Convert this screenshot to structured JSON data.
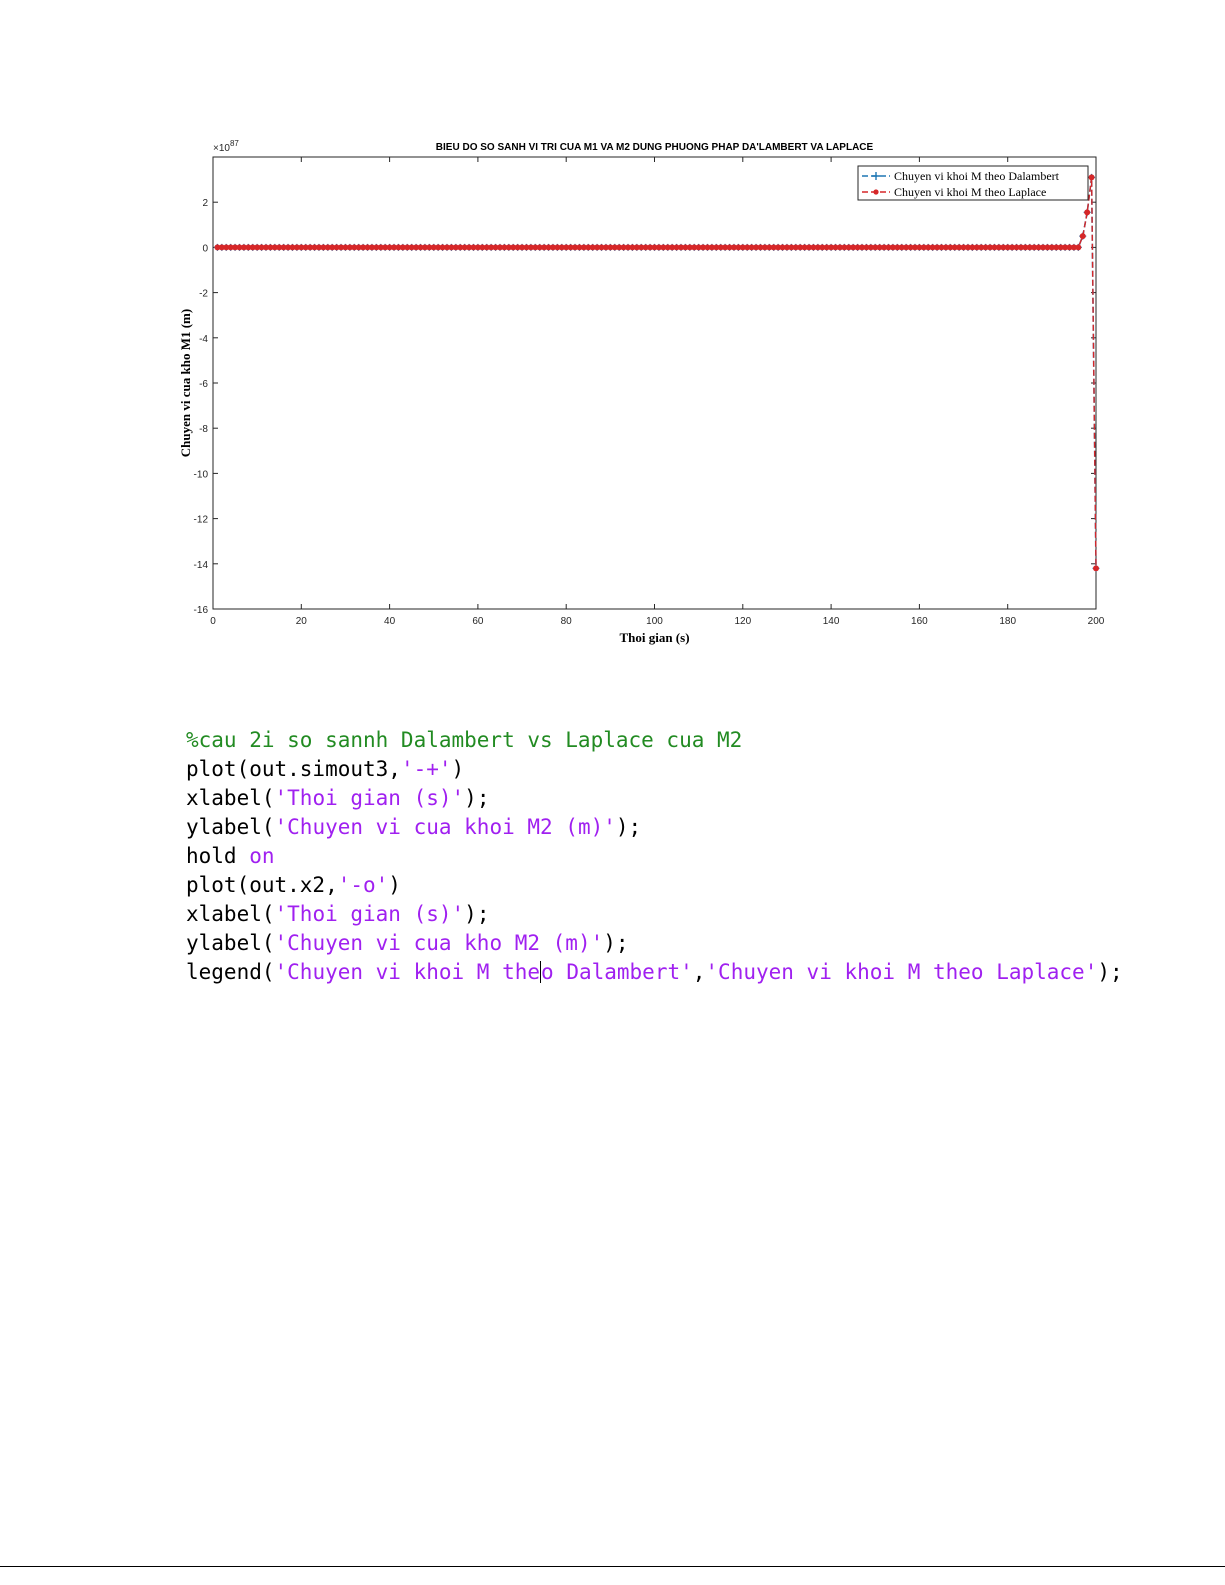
{
  "chart_data": {
    "type": "line",
    "title": "BIEU DO SO SANH VI TRI CUA M1 VA M2 DUNG PHUONG PHAP DA'LAMBERT VA LAPLACE",
    "xlabel": "Thoi gian (s)",
    "ylabel": "Chuyen vi cua kho M1 (m)",
    "y_exponent_label": "×10",
    "y_exponent": "87",
    "xlim": [
      0,
      200
    ],
    "ylim": [
      -16,
      4
    ],
    "x_ticks": [
      0,
      20,
      40,
      60,
      80,
      100,
      120,
      140,
      160,
      180,
      200
    ],
    "y_ticks": [
      2,
      0,
      -2,
      -4,
      -6,
      -8,
      -10,
      -12,
      -14,
      -16
    ],
    "x_tick_labels": [
      "0",
      "20",
      "40",
      "60",
      "80",
      "100",
      "120",
      "140",
      "160",
      "180",
      "200"
    ],
    "y_tick_labels": [
      "2",
      "0",
      "-2",
      "-4",
      "-6",
      "-8",
      "-10",
      "-12",
      "-14",
      "-16"
    ],
    "grid": false,
    "legend_position": "top-right",
    "series": [
      {
        "name": "Chuyen vi khoi M theo Dalambert",
        "color": "#1f77b4",
        "marker": "+",
        "x": [
          196,
          197,
          198,
          199,
          200
        ],
        "y": [
          0,
          0.5,
          1.55,
          3.1,
          -14.2
        ],
        "baseline": {
          "from": 1,
          "to": 195,
          "y": 0
        }
      },
      {
        "name": "Chuyen vi khoi M theo Laplace",
        "color": "#d62728",
        "marker": "o",
        "x": [
          196,
          197,
          198,
          199,
          200
        ],
        "y": [
          0,
          0.5,
          1.55,
          3.1,
          -14.2
        ],
        "baseline": {
          "from": 1,
          "to": 195,
          "y": 0
        }
      }
    ]
  },
  "code": {
    "lines": [
      [
        {
          "t": "%cau 2i so sannh Dalambert vs Laplace cua M2",
          "k": "comment"
        }
      ],
      [
        {
          "t": "plot(out.simout3,",
          "k": "plain"
        },
        {
          "t": "'-+'",
          "k": "string"
        },
        {
          "t": ")",
          "k": "plain"
        }
      ],
      [
        {
          "t": "xlabel(",
          "k": "plain"
        },
        {
          "t": "'Thoi gian (s)'",
          "k": "string"
        },
        {
          "t": ");",
          "k": "plain"
        }
      ],
      [
        {
          "t": "ylabel(",
          "k": "plain"
        },
        {
          "t": "'Chuyen vi cua khoi M2 (m)'",
          "k": "string"
        },
        {
          "t": ");",
          "k": "plain"
        }
      ],
      [
        {
          "t": "hold ",
          "k": "plain"
        },
        {
          "t": "on",
          "k": "keyword"
        }
      ],
      [
        {
          "t": "plot(out.x2,",
          "k": "plain"
        },
        {
          "t": "'-o'",
          "k": "string"
        },
        {
          "t": ")",
          "k": "plain"
        }
      ],
      [
        {
          "t": "xlabel(",
          "k": "plain"
        },
        {
          "t": "'Thoi gian (s)'",
          "k": "string"
        },
        {
          "t": ");",
          "k": "plain"
        }
      ],
      [
        {
          "t": "ylabel(",
          "k": "plain"
        },
        {
          "t": "'Chuyen vi cua kho M2 (m)'",
          "k": "string"
        },
        {
          "t": ");",
          "k": "plain"
        }
      ],
      [
        {
          "t": "legend(",
          "k": "plain"
        },
        {
          "t": "'Chuyen vi khoi M the",
          "k": "string"
        },
        {
          "t": "",
          "k": "caret"
        },
        {
          "t": "o Dalambert'",
          "k": "string"
        },
        {
          "t": ",",
          "k": "plain"
        },
        {
          "t": "'Chuyen vi khoi M theo Laplace'",
          "k": "string"
        },
        {
          "t": ");",
          "k": "plain"
        }
      ]
    ]
  }
}
